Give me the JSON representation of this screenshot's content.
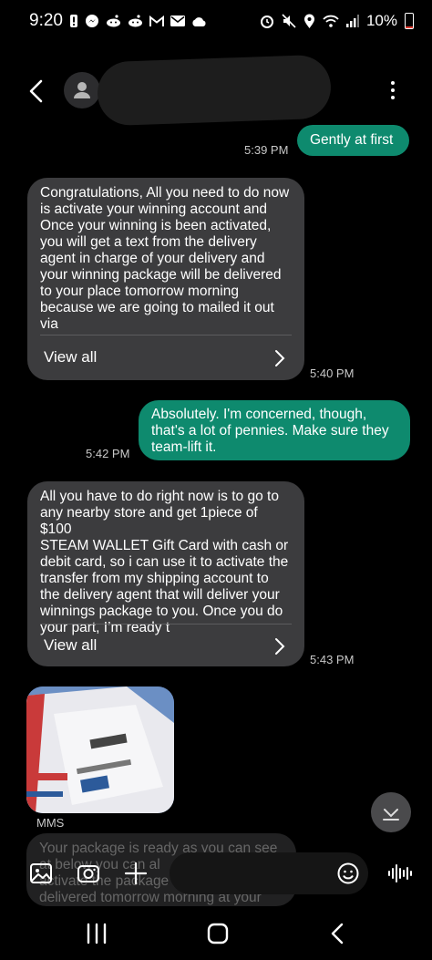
{
  "status_bar": {
    "time": "9:20",
    "battery_percent": "10%",
    "battery_level": 0.1,
    "left_icons": [
      "alert-icon",
      "messenger-icon",
      "reddit-icon",
      "reddit-icon",
      "gmail-icon",
      "mail-icon",
      "cloud-icon"
    ],
    "right_icons": [
      "alarm-icon",
      "mute-icon",
      "location-icon",
      "wifi-icon",
      "signal-icon"
    ]
  },
  "header": {
    "back_icon": "back-chevron-icon",
    "avatar_icon": "person-icon",
    "menu_icon": "more-vert-icon"
  },
  "messages": [
    {
      "direction": "out",
      "text": "Gently at first",
      "time": "5:39 PM"
    },
    {
      "direction": "in",
      "text": "Congratulations, All you need to do now\nis activate your winning account and\nOnce your winning is been activated,\nyou will get a text from the delivery\nagent in charge of your delivery and\nyour winning package will be delivered\nto your place tomorrow morning\nbecause we are going to mailed it out\nvia",
      "view_all": "View all",
      "time": "5:40 PM"
    },
    {
      "direction": "out",
      "text": "Absolutely. I'm concerned, though,\nthat's a lot of pennies. Make sure they\nteam-lift it.",
      "time": "5:42 PM"
    },
    {
      "direction": "in",
      "text": "All you have to do right now is to go to\nany nearby store and get 1piece of $100\nSTEAM WALLET  Gift Card with cash or\ndebit card, so i can use it to activate the\ntransfer from my shipping account to\nthe delivery agent that will deliver your\nwinnings package to you. Once you do\nyour part, I’m ready t",
      "view_all": "View all",
      "time": "5:43 PM"
    },
    {
      "direction": "in",
      "type": "mms",
      "label": "MMS"
    },
    {
      "direction": "in",
      "text": "Your package is ready as you can see\nat below you can al\nactivate the package\ndelivered tomorrow morning at your"
    }
  ],
  "compose": {
    "gallery_icon": "image-icon",
    "camera_icon": "camera-icon",
    "add_icon": "plus-icon",
    "emoji_icon": "emoji-icon",
    "voice_icon": "voice-wave-icon",
    "scroll_icon": "chevron-down-icon"
  },
  "nav_bar": {
    "recents_icon": "recents-icon",
    "home_icon": "home-icon",
    "back_icon": "back-icon"
  },
  "colors": {
    "outgoing": "#0e8a6e",
    "incoming": "#3c3c3e",
    "background": "#000000"
  }
}
